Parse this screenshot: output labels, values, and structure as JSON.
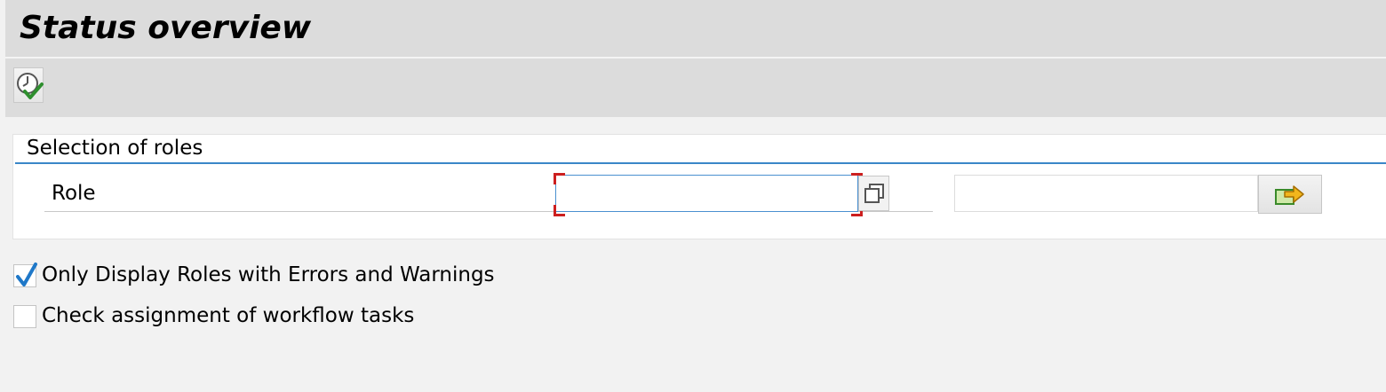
{
  "header": {
    "title": "Status overview"
  },
  "toolbar": {
    "execute_icon": "clock-check-icon"
  },
  "selection_group": {
    "title": "Selection of roles",
    "role_field": {
      "label": "Role",
      "from_value": "",
      "to_value": "",
      "multiple_selection_icon": "multiple-selection-icon",
      "more_button_icon": "arrow-right-folder-icon"
    }
  },
  "options": [
    {
      "label": "Only Display Roles with Errors and Warnings",
      "checked": true
    },
    {
      "label": "Check assignment of workflow tasks",
      "checked": false
    }
  ],
  "colors": {
    "accent": "#3a87c8",
    "required_marker": "#cc1f1f",
    "check_mark": "#1f78c8"
  }
}
